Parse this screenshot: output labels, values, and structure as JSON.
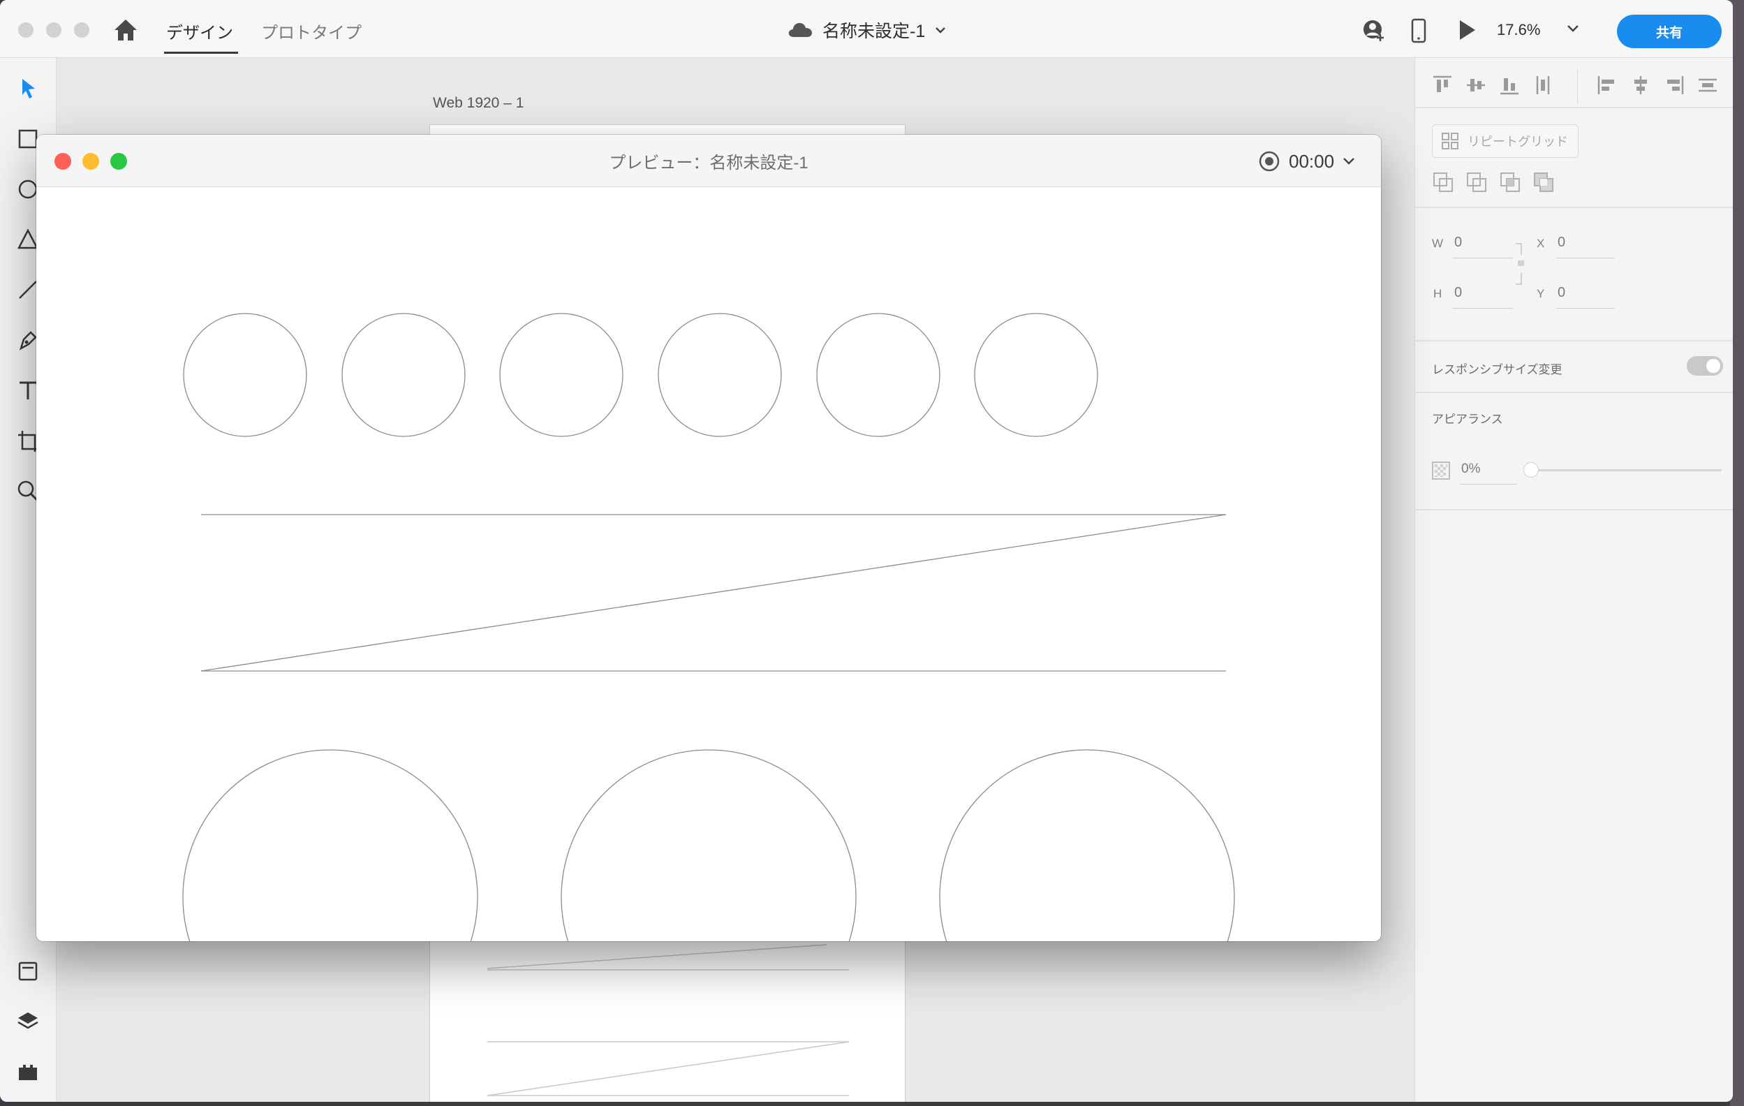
{
  "window": {
    "tabs": [
      {
        "label": "デザイン",
        "active": true
      },
      {
        "label": "プロトタイプ",
        "active": false
      }
    ],
    "document_title": "名称未設定-1",
    "zoom": "17.6%",
    "share_label": "共有"
  },
  "canvas": {
    "artboard_label": "Web 1920 – 1"
  },
  "properties": {
    "repeat_grid_label": "リピートグリッド",
    "w_label": "W",
    "w_value": "0",
    "x_label": "X",
    "x_value": "0",
    "h_label": "H",
    "h_value": "0",
    "y_label": "Y",
    "y_value": "0",
    "responsive_label": "レスポンシブサイズ変更",
    "responsive_on": true,
    "appearance_title": "アピアランス",
    "opacity_value": "0%"
  },
  "preview": {
    "title": "プレビュー：名称未設定-1",
    "record_time": "00:00"
  },
  "colors": {
    "accent": "#1a8cf0",
    "select_tool": "#1a8cf0",
    "close": "#fe5f57",
    "minimize": "#febc2e",
    "maximize": "#28c840"
  }
}
